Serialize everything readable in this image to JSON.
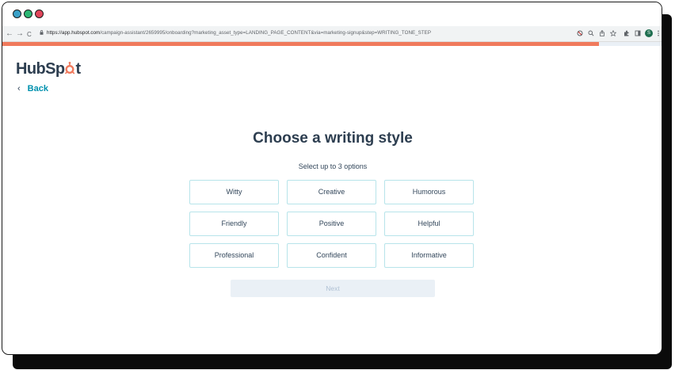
{
  "browser": {
    "url_host": "https://app.hubspot.com",
    "url_path": "/campaign-assistant/2659995/onboarding?marketing_asset_type=LANDING_PAGE_CONTENT&via=marketing-signup&step=WRITING_TONE_STEP",
    "profile_initial": "S",
    "nav": {
      "back": "←",
      "forward": "→",
      "reload": "C"
    }
  },
  "progress": {
    "fraction": 0.905
  },
  "brand": {
    "logo_text_left": "HubSp",
    "logo_text_right": "t",
    "accent": "#f07a5d"
  },
  "nav": {
    "back_label": "Back"
  },
  "main": {
    "heading": "Choose a writing style",
    "subheading": "Select up to 3 options",
    "options": [
      "Witty",
      "Creative",
      "Humorous",
      "Friendly",
      "Positive",
      "Helpful",
      "Professional",
      "Confident",
      "Informative"
    ],
    "next_label": "Next"
  },
  "colors": {
    "option_border": "#b7e4ea",
    "heading": "#2d3e50",
    "link": "#0091ae",
    "next_bg": "#eaf0f6"
  }
}
